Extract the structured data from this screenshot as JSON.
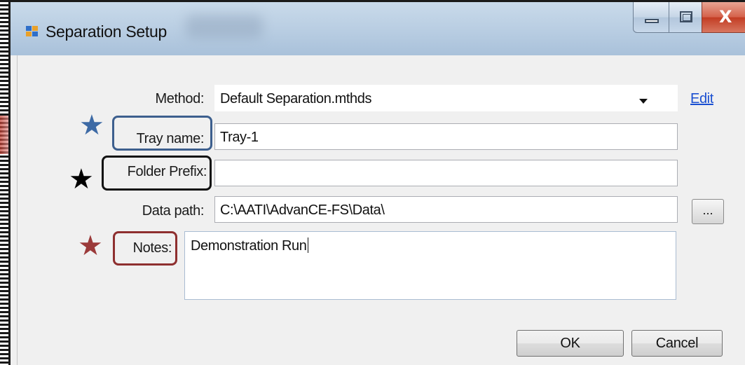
{
  "window": {
    "title": "Separation Setup",
    "controls": {
      "minimize": "minimize",
      "maximize": "maximize",
      "close": "X"
    }
  },
  "form": {
    "method": {
      "label": "Method:",
      "value": "Default Separation.mthds",
      "edit_link": "Edit"
    },
    "tray_name": {
      "label": "Tray name:",
      "value": "Tray-1"
    },
    "folder_prefix": {
      "label": "Folder Prefix:",
      "value": ""
    },
    "data_path": {
      "label": "Data path:",
      "value": "C:\\AATI\\AdvanCE-FS\\Data\\",
      "browse_label": "..."
    },
    "notes": {
      "label": "Notes:",
      "value": "Demonstration Run"
    }
  },
  "annotations": {
    "star_glyph": "★",
    "colors": {
      "tray_name": "#3d5f8e",
      "folder_prefix": "#111111",
      "notes": "#8e2f2f"
    }
  },
  "buttons": {
    "ok": "OK",
    "cancel": "Cancel"
  }
}
